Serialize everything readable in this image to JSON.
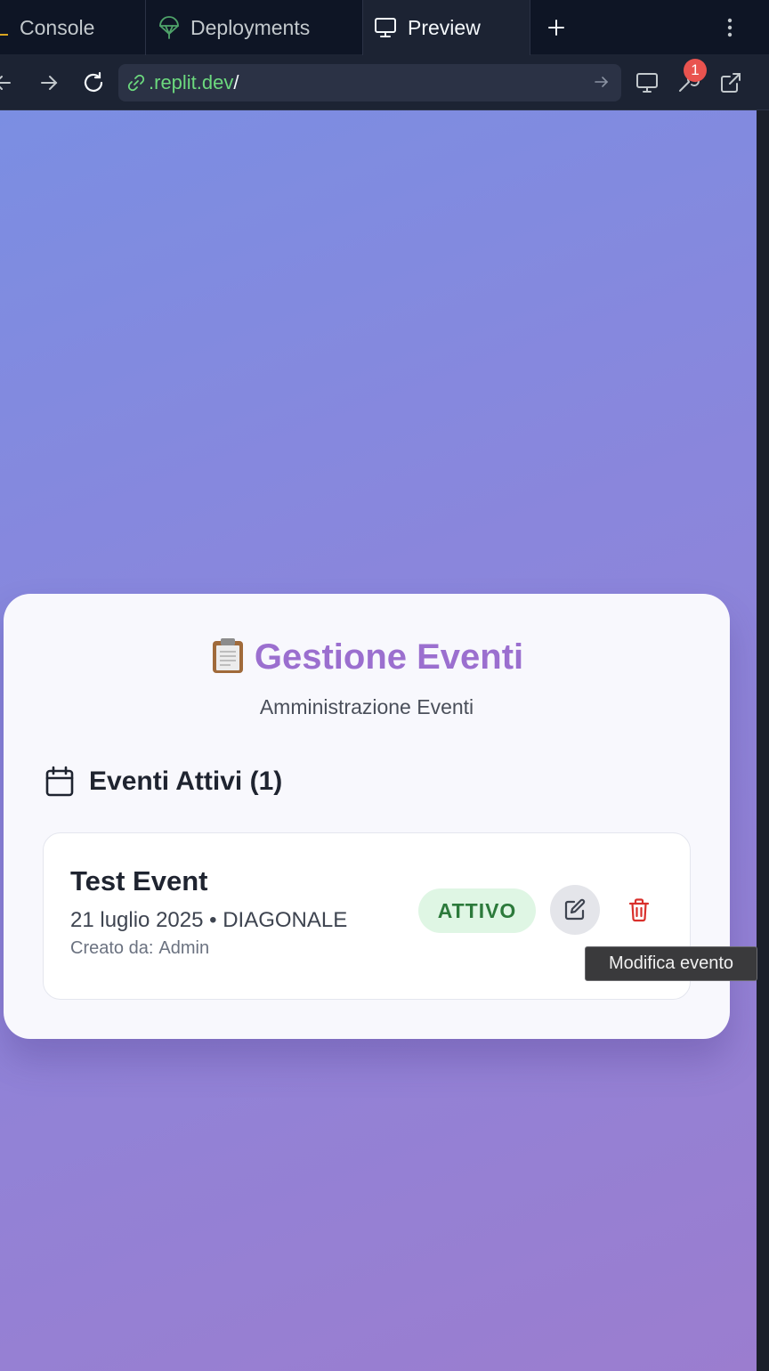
{
  "tabs": {
    "console": "Console",
    "deployments": "Deployments",
    "preview": "Preview"
  },
  "address": {
    "domain": ".replit.dev",
    "path": "/",
    "notification_count": "1"
  },
  "app": {
    "title": "Gestione Eventi",
    "subtitle": "Amministrazione Eventi",
    "section_title": "Eventi Attivi (1)",
    "event": {
      "name": "Test Event",
      "meta": "21 luglio 2025 • DIAGONALE",
      "creator_label": "Creato da:",
      "creator": "Admin",
      "status": "ATTIVO"
    },
    "tooltip": "Modifica evento"
  },
  "colors": {
    "accent": "#9b6fcf",
    "status_bg": "#dff6e4",
    "status_text": "#2c7a3b",
    "delete": "#d9302c",
    "url_domain": "#6cd97e"
  },
  "icons": {
    "title_icon": "clipboard-icon",
    "section_icon": "calendar-icon",
    "edit": "edit-icon",
    "delete": "trash-icon"
  }
}
